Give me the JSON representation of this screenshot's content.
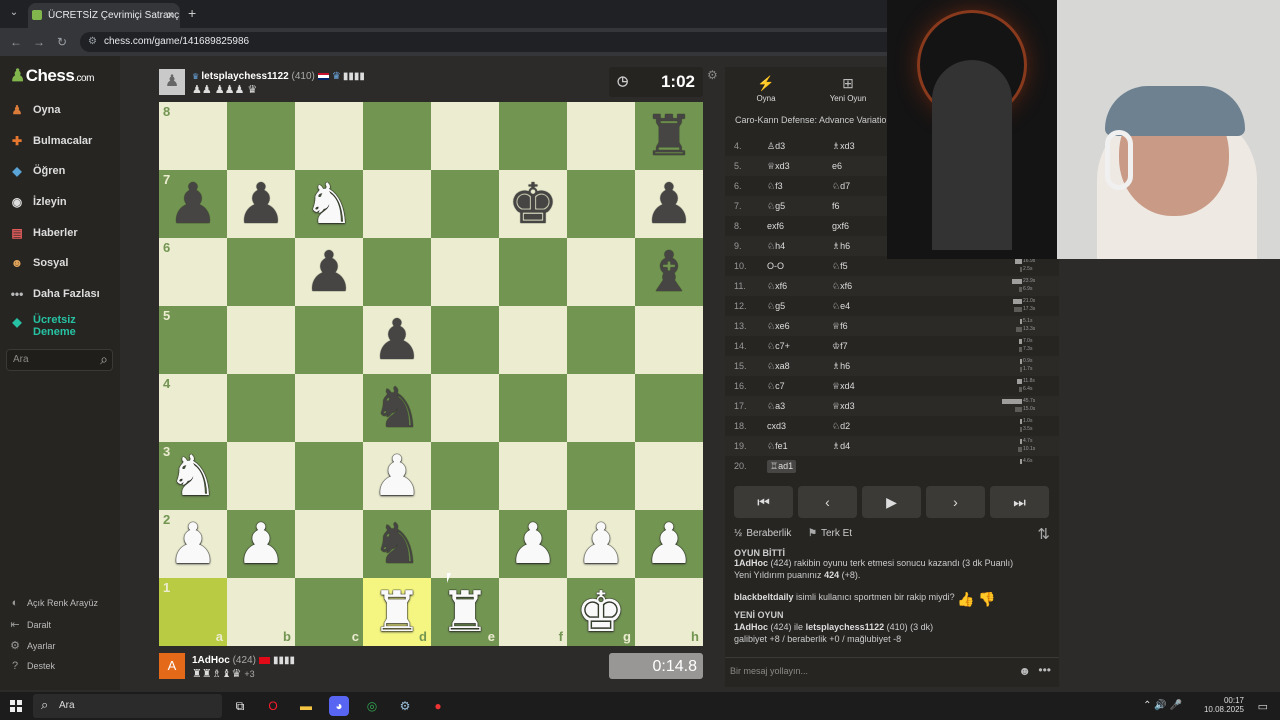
{
  "browser": {
    "tab_title": "ÜCRETSİZ Çevrimiçi Satranç Oyn",
    "url": "chess.com/game/141689825986"
  },
  "nav": {
    "logo": "Chess",
    "logo_suffix": ".com",
    "items": [
      "Oyna",
      "Bulmacalar",
      "Öğren",
      "İzleyin",
      "Haberler",
      "Sosyal",
      "Daha Fazlası"
    ],
    "trial_line1": "Ücretsiz",
    "trial_line2": "Deneme",
    "search_placeholder": "Ara",
    "footer": [
      "Açık Renk Arayüz",
      "Daralt",
      "Ayarlar",
      "Destek"
    ]
  },
  "top_player": {
    "name": "letsplaychess1122",
    "rating": "(410)",
    "captured": "♟♟ ♟♟♟ ♛",
    "clock": "1:02"
  },
  "bottom_player": {
    "avatar_letter": "A",
    "name": "1AdHoc",
    "rating": "(424)",
    "captured": "♜♜♗♝♛",
    "advantage": "+3",
    "clock": "0:14.8"
  },
  "board": {
    "light_color": "#ebecd0",
    "dark_color": "#739552",
    "highlight_light": "#f5f682",
    "highlight_dark": "#b9ca43",
    "highlighted_squares": [
      "a1",
      "d1"
    ],
    "ranks": [
      "8",
      "7",
      "6",
      "5",
      "4",
      "3",
      "2",
      "1"
    ],
    "files": [
      "a",
      "b",
      "c",
      "d",
      "e",
      "f",
      "g",
      "h"
    ],
    "pieces": [
      {
        "sq": "h8",
        "glyph": "♜",
        "color": "b"
      },
      {
        "sq": "a7",
        "glyph": "♟",
        "color": "b"
      },
      {
        "sq": "b7",
        "glyph": "♟",
        "color": "b"
      },
      {
        "sq": "c7",
        "glyph": "♞",
        "color": "w"
      },
      {
        "sq": "f7",
        "glyph": "♚",
        "color": "b"
      },
      {
        "sq": "h7",
        "glyph": "♟",
        "color": "b"
      },
      {
        "sq": "c6",
        "glyph": "♟",
        "color": "b"
      },
      {
        "sq": "h6",
        "glyph": "♝",
        "color": "b"
      },
      {
        "sq": "d5",
        "glyph": "♟",
        "color": "b"
      },
      {
        "sq": "d4",
        "glyph": "♞",
        "color": "b"
      },
      {
        "sq": "a3",
        "glyph": "♞",
        "color": "w"
      },
      {
        "sq": "d3",
        "glyph": "♟",
        "color": "w"
      },
      {
        "sq": "a2",
        "glyph": "♟",
        "color": "w"
      },
      {
        "sq": "b2",
        "glyph": "♟",
        "color": "w"
      },
      {
        "sq": "d2",
        "glyph": "♞",
        "color": "b"
      },
      {
        "sq": "f2",
        "glyph": "♟",
        "color": "w"
      },
      {
        "sq": "g2",
        "glyph": "♟",
        "color": "w"
      },
      {
        "sq": "h2",
        "glyph": "♟",
        "color": "w"
      },
      {
        "sq": "d1",
        "glyph": "♜",
        "color": "w"
      },
      {
        "sq": "e1",
        "glyph": "♜",
        "color": "w"
      },
      {
        "sq": "g1",
        "glyph": "♚",
        "color": "w"
      }
    ]
  },
  "panel": {
    "tab_play": "Oyna",
    "tab_new": "Yeni Oyun",
    "opening": "Caro-Kann Defense: Advance Variation",
    "moves": [
      {
        "n": "4.",
        "w": "d3",
        "wi": "♙",
        "b": "xd3",
        "bi": "♗"
      },
      {
        "n": "5.",
        "w": "xd3",
        "wi": "♕",
        "b": "e6",
        "bi": ""
      },
      {
        "n": "6.",
        "w": "f3",
        "wi": "♘",
        "b": "d7",
        "bi": "♘"
      },
      {
        "n": "7.",
        "w": "g5",
        "wi": "♘",
        "b": "f6",
        "bi": ""
      },
      {
        "n": "8.",
        "w": "exf6",
        "wi": "",
        "b": "gxf6",
        "bi": ""
      },
      {
        "n": "9.",
        "w": "h4",
        "wi": "♘",
        "b": "h6",
        "bi": "♗"
      },
      {
        "n": "10.",
        "w": "O-O",
        "wi": "",
        "b": "f5",
        "bi": "♘"
      },
      {
        "n": "11.",
        "w": "xf6",
        "wi": "♘",
        "b": "xf6",
        "bi": "♘"
      },
      {
        "n": "12.",
        "w": "g5",
        "wi": "♘",
        "b": "e4",
        "bi": "♘"
      },
      {
        "n": "13.",
        "w": "xe6",
        "wi": "♘",
        "b": "f6",
        "bi": "♕"
      },
      {
        "n": "14.",
        "w": "c7+",
        "wi": "♘",
        "b": "f7",
        "bi": "♔"
      },
      {
        "n": "15.",
        "w": "xa8",
        "wi": "♘",
        "b": "h6",
        "bi": "♗"
      },
      {
        "n": "16.",
        "w": "c7",
        "wi": "♘",
        "b": "xd4",
        "bi": "♕"
      },
      {
        "n": "17.",
        "w": "a3",
        "wi": "♘",
        "b": "xd3",
        "bi": "♕"
      },
      {
        "n": "18.",
        "w": "cxd3",
        "wi": "",
        "b": "d2",
        "bi": "♘"
      },
      {
        "n": "19.",
        "w": "fe1",
        "wi": "♘",
        "b": "d4",
        "bi": "♗"
      },
      {
        "n": "20.",
        "w": "ad1",
        "wi": "♖",
        "b": "",
        "bi": ""
      }
    ],
    "times": [
      {
        "row": 6,
        "w": "16.9s",
        "wv": 0.37,
        "b": "2.5s",
        "bv": 0.06
      },
      {
        "row": 7,
        "w": "23.9s",
        "wv": 0.52,
        "b": "6.9s",
        "bv": 0.15
      },
      {
        "row": 8,
        "w": "21.0s",
        "wv": 0.46,
        "b": "17.3s",
        "bv": 0.38
      },
      {
        "row": 9,
        "w": "5.1s",
        "wv": 0.11,
        "b": "13.3s",
        "bv": 0.29
      },
      {
        "row": 10,
        "w": "7.0s",
        "wv": 0.15,
        "b": "7.3s",
        "bv": 0.16
      },
      {
        "row": 11,
        "w": "0.9s",
        "wv": 0.02,
        "b": "1.7s",
        "bv": 0.04
      },
      {
        "row": 12,
        "w": "11.8s",
        "wv": 0.26,
        "b": "6.4s",
        "bv": 0.14
      },
      {
        "row": 13,
        "w": "45.7s",
        "wv": 1.0,
        "b": "15.0s",
        "bv": 0.33
      },
      {
        "row": 14,
        "w": "1.0s",
        "wv": 0.02,
        "b": "3.5s",
        "bv": 0.08
      },
      {
        "row": 15,
        "w": "4.7s",
        "wv": 0.1,
        "b": "10.1s",
        "bv": 0.22
      },
      {
        "row": 16,
        "w": "4.6s",
        "wv": 0.1,
        "b": "",
        "bv": 0
      }
    ],
    "draw_label": "Beraberlik",
    "resign_label": "Terk Et",
    "chat": {
      "game_over": "OYUN BİTTİ",
      "result_user": "1AdHoc",
      "result_text": "(424) rakibin oyunu terk etmesi sonucu kazandı (3 dk Puanlı)",
      "new_rating_text": "Yeni Yıldırım puanınız",
      "new_rating": "424",
      "new_rating_delta": "(+8).",
      "sportsman_user": "blackbeltdaily",
      "sportsman_text": "isimli kullanıcı sportmen bir rakip miydi?",
      "new_game": "YENİ OYUN",
      "ng_user1": "1AdHoc",
      "ng_mid": "(424) ile",
      "ng_user2": "letsplaychess1122",
      "ng_tail": "(410) (3 dk)",
      "odds": "galibiyet +8 / beraberlik +0 / mağlubiyet -8",
      "input_placeholder": "Bir mesaj yollayın..."
    }
  },
  "taskbar": {
    "search": "Ara",
    "time": "00:17",
    "date": "10.08.2025"
  }
}
